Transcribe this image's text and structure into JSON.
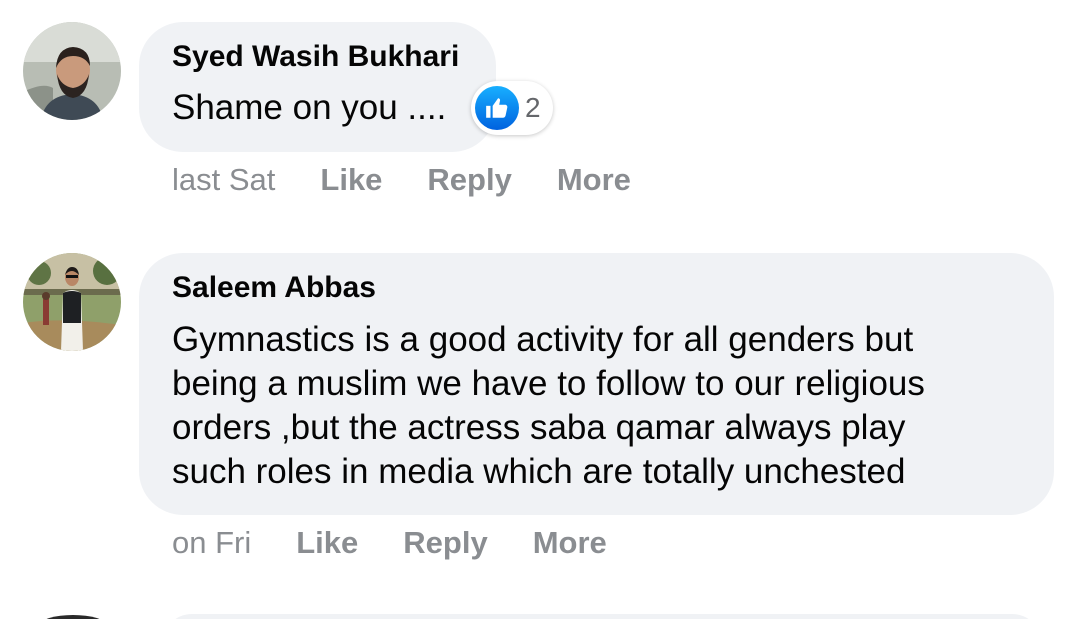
{
  "comments": [
    {
      "author": "Syed Wasih Bukhari",
      "text_lines": [
        "Shame on you ...."
      ],
      "reaction": {
        "icon": "thumbs-up-icon",
        "count": "2"
      },
      "time": "last Sat",
      "actions": [
        "Like",
        "Reply",
        "More"
      ]
    },
    {
      "author": "Saleem Abbas",
      "text_lines": [
        "Gymnastics is a good activity for all genders but",
        "being a muslim we have to follow to our religious",
        "orders ,but the actress saba qamar always play",
        "such roles in media which are totally unchested"
      ],
      "time": "on Fri",
      "actions": [
        "Like",
        "Reply",
        "More"
      ]
    }
  ],
  "colors": {
    "bubble": "#f0f2f5",
    "text": "#050505",
    "meta": "#8a8d91",
    "like_blue": "#0866ff"
  }
}
